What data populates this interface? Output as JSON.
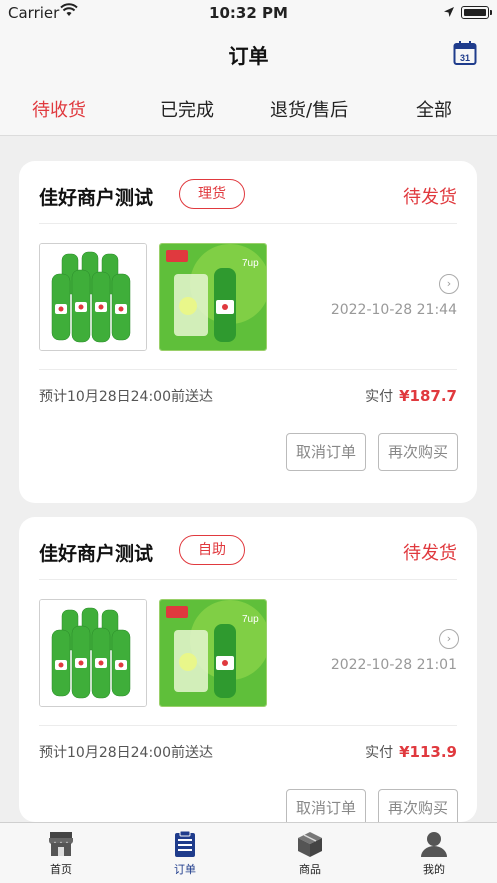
{
  "status_bar": {
    "carrier": "Carrier",
    "time": "10:32 PM"
  },
  "nav": {
    "title": "订单",
    "calendar_day": "31"
  },
  "tabs": [
    {
      "label": "待收货",
      "active": true
    },
    {
      "label": "已完成",
      "active": false
    },
    {
      "label": "退货/售后",
      "active": false
    },
    {
      "label": "全部",
      "active": false
    }
  ],
  "orders": [
    {
      "merchant": "佳好商户测试",
      "tag": "理货",
      "status": "待发货",
      "products": [
        "7up-6-bottle-pack",
        "7up-bottle-and-glass"
      ],
      "datetime": "2022-10-28 21:44",
      "eta": "预计10月28日24:00前送达",
      "paid_label": "实付",
      "paid_amount": "¥187.7",
      "cancel_label": "取消订单",
      "rebuy_label": "再次购买"
    },
    {
      "merchant": "佳好商户测试",
      "tag": "自助",
      "status": "待发货",
      "products": [
        "7up-6-bottle-pack",
        "7up-bottle-and-glass"
      ],
      "datetime": "2022-10-28 21:01",
      "eta": "预计10月28日24:00前送达",
      "paid_label": "实付",
      "paid_amount": "¥113.9",
      "cancel_label": "取消订单",
      "rebuy_label": "再次购买"
    }
  ],
  "tabbar": [
    {
      "label": "首页",
      "icon": "store-icon",
      "active": false
    },
    {
      "label": "订单",
      "icon": "clipboard-icon",
      "active": true
    },
    {
      "label": "商品",
      "icon": "box-icon",
      "active": false
    },
    {
      "label": "我的",
      "icon": "person-icon",
      "active": false
    }
  ],
  "colors": {
    "accent": "#e0393e",
    "tab_active": "#1f3c8c"
  }
}
